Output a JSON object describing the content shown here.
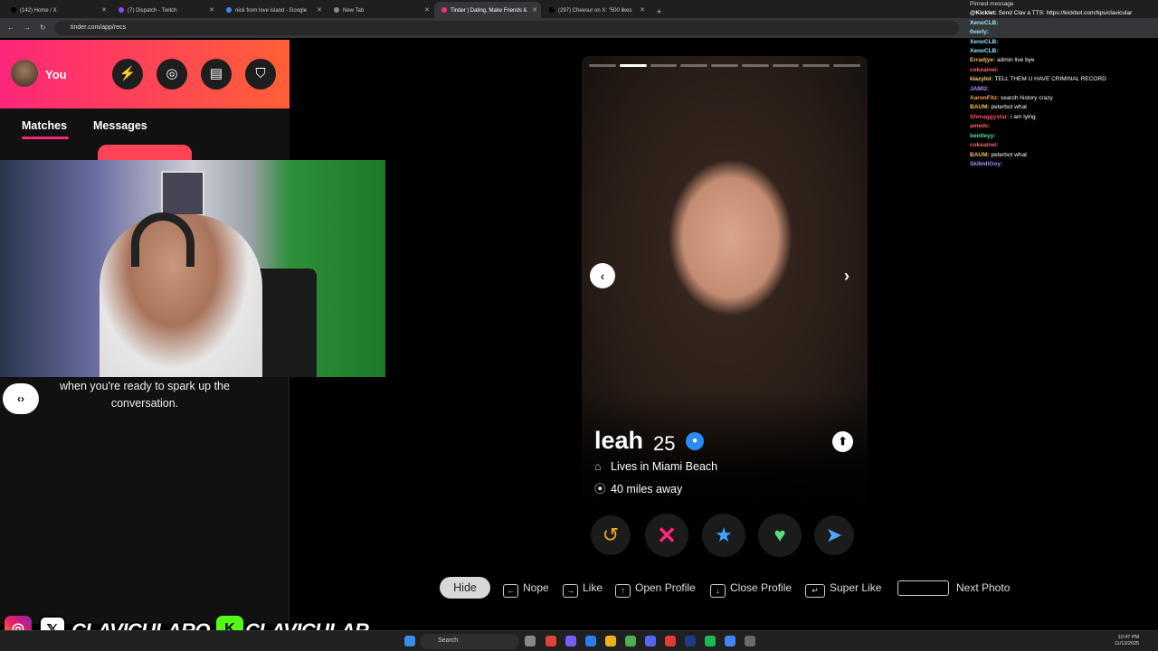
{
  "browser": {
    "tabs": [
      {
        "label": "(142) Home / X",
        "active": false,
        "fav": "#000"
      },
      {
        "label": "(7) Dispatch - Twitch",
        "active": false,
        "fav": "#9146ff"
      },
      {
        "label": "nick from love island - Google",
        "active": false,
        "fav": "#4285f4"
      },
      {
        "label": "New Tab",
        "active": false,
        "fav": "#888"
      },
      {
        "label": "Tinder | Dating, Make Friends &",
        "active": true,
        "fav": "#fd267a"
      },
      {
        "label": "(297) Cheesur on X: \"500 likes",
        "active": false,
        "fav": "#000"
      }
    ],
    "url": "tinder.com/app/recs"
  },
  "tinder": {
    "profile_label": "You",
    "header_icons": [
      "bolt-icon",
      "compass-icon",
      "briefcase-icon",
      "shield-icon"
    ],
    "tabs": {
      "matches": "Matches",
      "messages": "Messages"
    },
    "hint": "when you're ready to spark up the conversation.",
    "card": {
      "name": "leah",
      "age": "25",
      "lives": "Lives in Miami Beach",
      "distance": "40 miles away",
      "photo_count": 9,
      "current_photo": 2
    },
    "actions": [
      "rewind-icon",
      "nope-icon",
      "super-like-icon",
      "like-icon",
      "boost-icon"
    ],
    "shortcuts": {
      "hide": "Hide",
      "nope": "Nope",
      "like": "Like",
      "open_profile": "Open Profile",
      "close_profile": "Close Profile",
      "super_like": "Super Like",
      "next_photo": "Next Photo"
    }
  },
  "chat": {
    "pinned": "Pinned message",
    "lines": [
      {
        "user": "@Kicklet:",
        "msg": "Send Clav a TTS: https://kickbot.com/tips/clavicular",
        "color": "#ffffff"
      },
      {
        "user": "XenoCLB:",
        "msg": "",
        "color": "#9be3ff"
      },
      {
        "user": "0verly:",
        "msg": "",
        "color": "#9be3ff"
      },
      {
        "user": "XenoCLB:",
        "msg": "",
        "color": "#9be3ff"
      },
      {
        "user": "XenoCLB:",
        "msg": "",
        "color": "#9be3ff"
      },
      {
        "user": "Erradjye:",
        "msg": "admin live bye",
        "color": "#f2c14e"
      },
      {
        "user": "cokeainei:",
        "msg": "",
        "color": "#f26a6a"
      },
      {
        "user": "klazyIol:",
        "msg": "TELL THEM U HAVE CRIMINAL RECORD",
        "color": "#ffd27f"
      },
      {
        "user": "JAMI2:",
        "msg": "",
        "color": "#b58cff"
      },
      {
        "user": "AaronFitz:",
        "msg": "search history crazy",
        "color": "#f2a64e"
      },
      {
        "user": "BAUM:",
        "msg": "peterbot what",
        "color": "#f2c14e"
      },
      {
        "user": "Shmaggystar:",
        "msg": "i am lying",
        "color": "#ff4d6d"
      },
      {
        "user": "amedc:",
        "msg": "",
        "color": "#f26a6a"
      },
      {
        "user": "bentleyy:",
        "msg": "",
        "color": "#4ee39a"
      },
      {
        "user": "cokeainei:",
        "msg": "",
        "color": "#f26a6a"
      },
      {
        "user": "BAUM:",
        "msg": "peterbot what",
        "color": "#f2c14e"
      },
      {
        "user": "SkibidiGoy:",
        "msg": "",
        "color": "#b58cff"
      }
    ]
  },
  "overlay": {
    "name1": "CLAVICULARO",
    "name2": "CLAVICULAR",
    "icons": [
      "instagram-icon",
      "x-icon",
      "kick-icon"
    ]
  },
  "taskbar": {
    "search_placeholder": "Search",
    "time": "10:47 PM",
    "date": "11/13/2025"
  }
}
